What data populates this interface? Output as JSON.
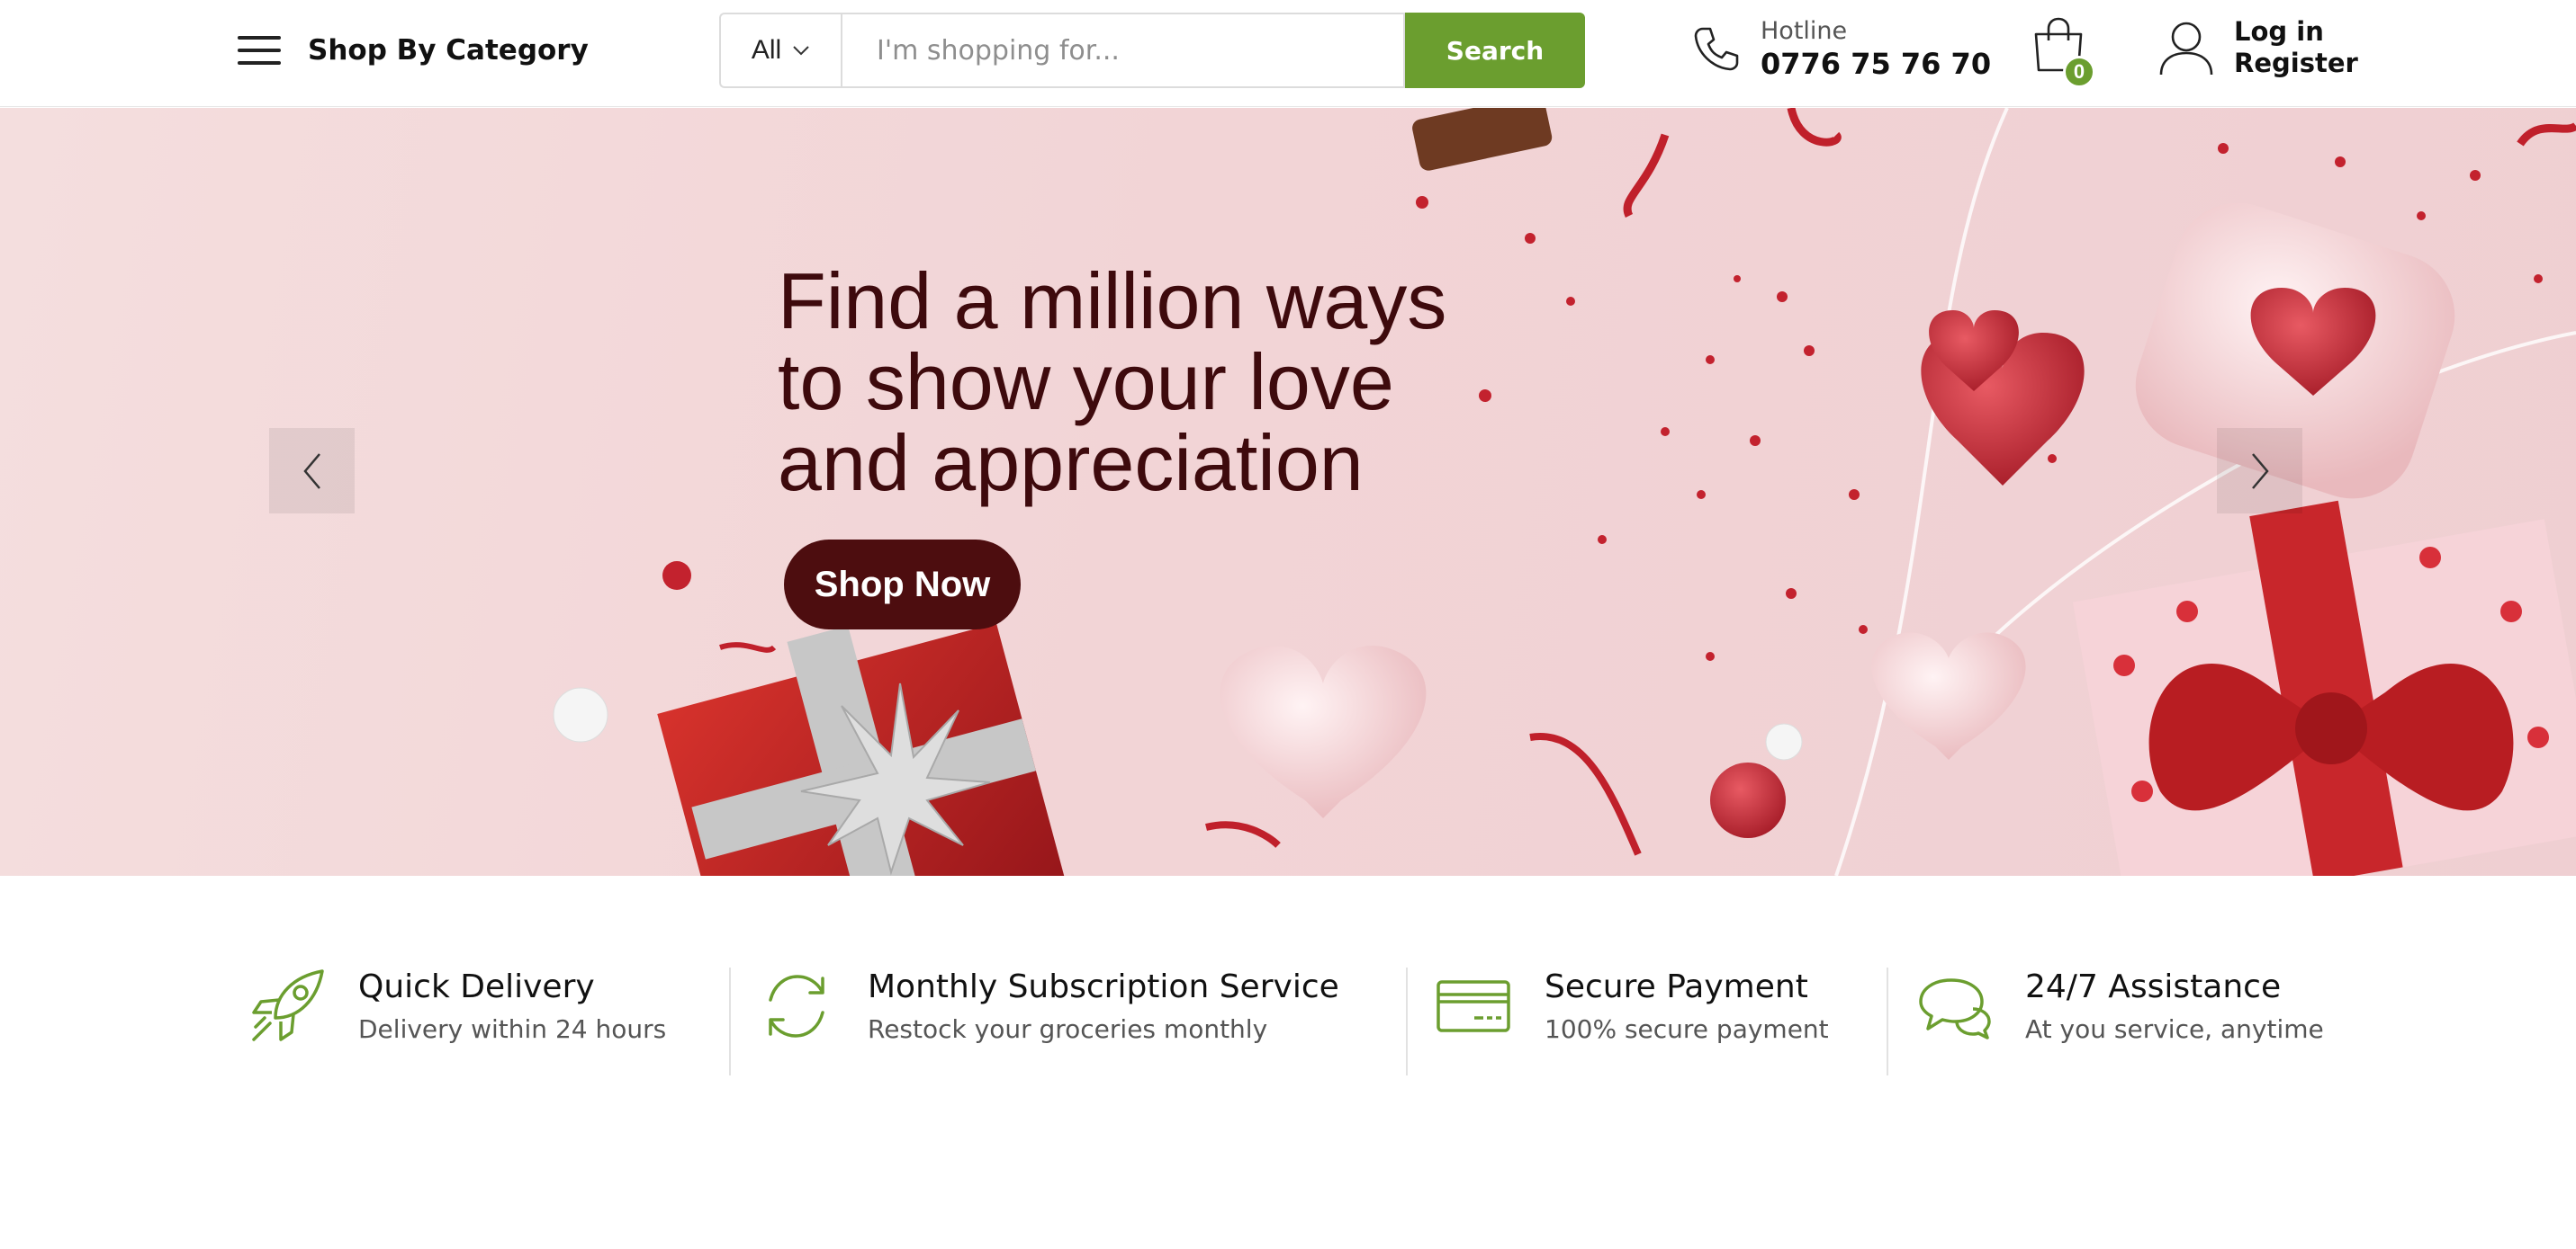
{
  "header": {
    "category_label": "Shop By Category",
    "search": {
      "scope": "All",
      "placeholder": "I'm shopping for...",
      "button_label": "Search"
    },
    "hotline": {
      "label": "Hotline",
      "number": "0776 75 76 70"
    },
    "cart": {
      "count": "0"
    },
    "account": {
      "login_label": "Log in",
      "register_label": "Register"
    }
  },
  "hero": {
    "title_line1": "Find a million ways",
    "title_line2": "to show your love",
    "title_line3": "and appreciation",
    "cta_label": "Shop Now"
  },
  "features": [
    {
      "icon": "rocket-icon",
      "title": "Quick Delivery",
      "desc": "Delivery within 24 hours"
    },
    {
      "icon": "refresh-icon",
      "title": "Monthly Subscription Service",
      "desc": "Restock your groceries monthly"
    },
    {
      "icon": "credit-card-icon",
      "title": "Secure Payment",
      "desc": "100% secure payment"
    },
    {
      "icon": "chat-bubbles-icon",
      "title": "24/7 Assistance",
      "desc": "At you service, anytime"
    }
  ],
  "colors": {
    "accent": "#6b9e2f",
    "hero_text": "#3e0a0d",
    "cta_bg": "#4d0d0f"
  }
}
